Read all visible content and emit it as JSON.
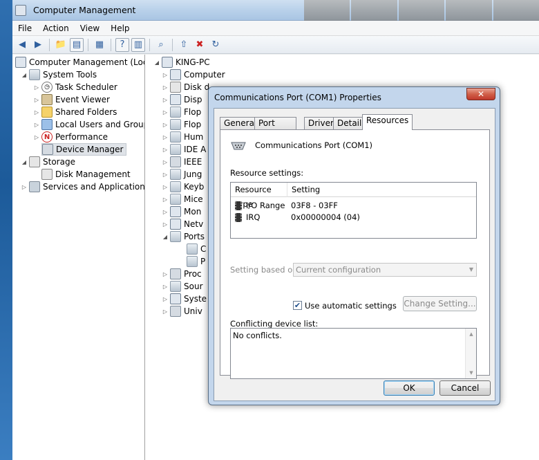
{
  "window": {
    "title": "Computer Management"
  },
  "menu": [
    "File",
    "Action",
    "View",
    "Help"
  ],
  "left_tree": [
    {
      "label": "Computer Management (Local",
      "icon": "computer-management-icon"
    },
    {
      "label": "System Tools",
      "icon": "system-tools-icon"
    },
    {
      "label": "Task Scheduler",
      "icon": "clock-icon"
    },
    {
      "label": "Event Viewer",
      "icon": "event-viewer-icon"
    },
    {
      "label": "Shared Folders",
      "icon": "shared-folders-icon"
    },
    {
      "label": "Local Users and Groups",
      "icon": "users-icon"
    },
    {
      "label": "Performance",
      "icon": "performance-icon"
    },
    {
      "label": "Device Manager",
      "icon": "device-manager-icon"
    },
    {
      "label": "Storage",
      "icon": "storage-icon"
    },
    {
      "label": "Disk Management",
      "icon": "disk-icon"
    },
    {
      "label": "Services and Applications",
      "icon": "services-icon"
    }
  ],
  "device_tree": [
    {
      "label": "KING-PC"
    },
    {
      "label": "Computer"
    },
    {
      "label": "Disk d"
    },
    {
      "label": "Disp"
    },
    {
      "label": "Flop"
    },
    {
      "label": "Flop"
    },
    {
      "label": "Hum"
    },
    {
      "label": "IDE A"
    },
    {
      "label": "IEEE"
    },
    {
      "label": "Jung"
    },
    {
      "label": "Keyb"
    },
    {
      "label": "Mice"
    },
    {
      "label": "Mon"
    },
    {
      "label": "Netv"
    },
    {
      "label": "Ports"
    },
    {
      "label": "C"
    },
    {
      "label": "P"
    },
    {
      "label": "Proc"
    },
    {
      "label": "Sour"
    },
    {
      "label": "Syste"
    },
    {
      "label": "Univ"
    }
  ],
  "dialog": {
    "title": "Communications Port (COM1) Properties",
    "close_symbol": "✕",
    "tabs": [
      "General",
      "Port Settings",
      "Driver",
      "Details",
      "Resources"
    ],
    "active_tab": "Resources",
    "device_name": "Communications Port (COM1)",
    "resource_settings_label": "Resource settings:",
    "columns": [
      "Resource type",
      "Setting"
    ],
    "resources": [
      {
        "type": "I/O Range",
        "setting": "03F8 - 03FF"
      },
      {
        "type": "IRQ",
        "setting": "0x00000004 (04)"
      }
    ],
    "setting_based_on_label": "Setting based on:",
    "setting_based_on_value": "Current configuration",
    "use_automatic_label": "Use automatic settings",
    "use_automatic_checked": true,
    "change_setting_label": "Change Setting...",
    "conflict_label": "Conflicting device list:",
    "conflict_text": "No conflicts.",
    "ok_label": "OK",
    "cancel_label": "Cancel"
  }
}
